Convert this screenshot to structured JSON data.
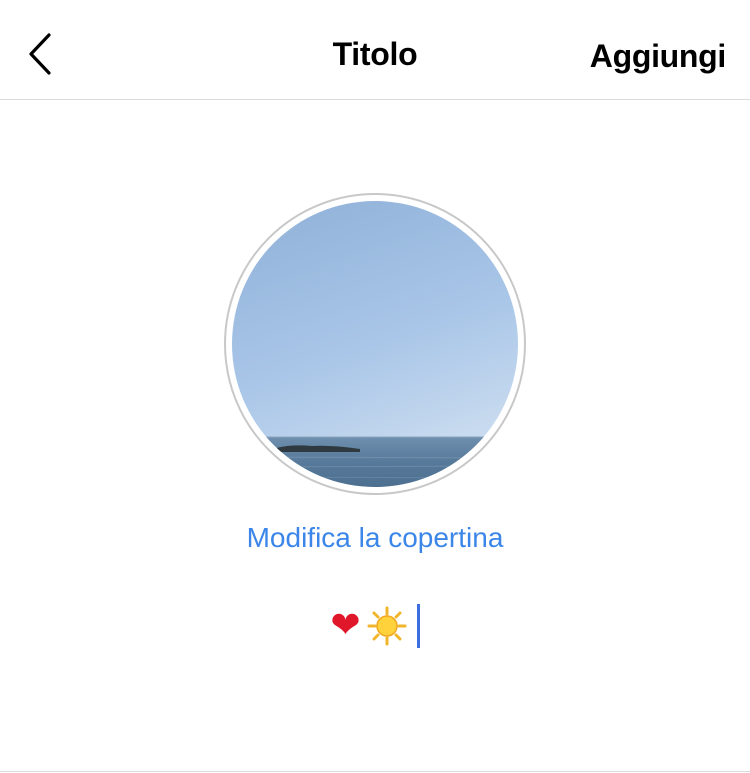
{
  "header": {
    "back_icon": "chevron-left-icon",
    "title": "Titolo",
    "action_label": "Aggiungi"
  },
  "cover": {
    "image": "sea-horizon-photo",
    "edit_label": "Modifica la copertina",
    "link_color": "#3b86e8"
  },
  "caption": {
    "emojis": [
      "❤️",
      "☀️"
    ],
    "heart": "❤",
    "cursor_color": "#3e6fe0"
  }
}
